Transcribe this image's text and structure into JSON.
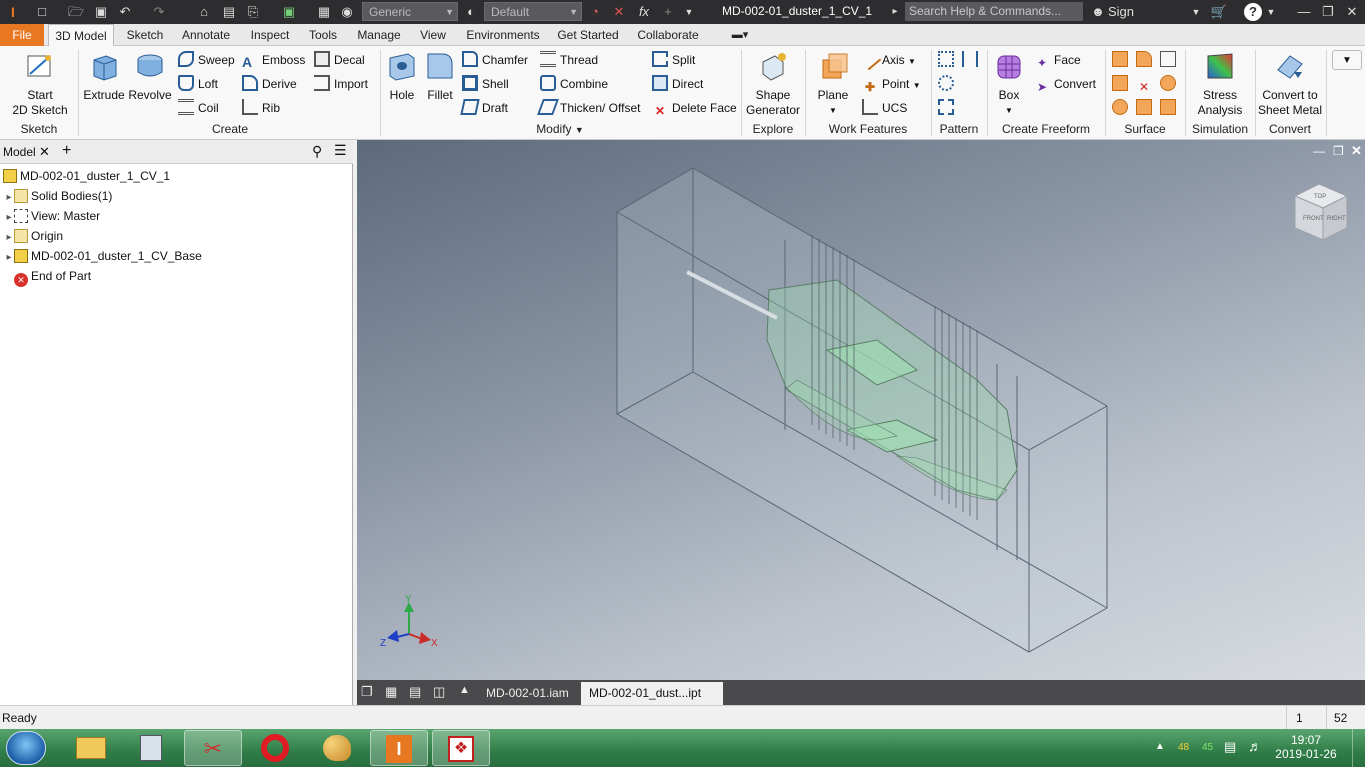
{
  "titlebar": {
    "material": "Generic",
    "appearance": "Default",
    "document_title": "MD-002-01_duster_1_CV_1",
    "search_placeholder": "Search Help & Commands...",
    "sign_in": "Sign In",
    "fx": "fx"
  },
  "tabs": [
    "File",
    "3D Model",
    "Sketch",
    "Annotate",
    "Inspect",
    "Tools",
    "Manage",
    "View",
    "Environments",
    "Get Started",
    "Collaborate"
  ],
  "ribbon": {
    "sketch": {
      "start_line1": "Start",
      "start_line2": "2D Sketch",
      "title": "Sketch"
    },
    "create": {
      "extrude": "Extrude",
      "revolve": "Revolve",
      "sweep": "Sweep",
      "loft": "Loft",
      "coil": "Coil",
      "emboss": "Emboss",
      "derive": "Derive",
      "rib": "Rib",
      "decal": "Decal",
      "import": "Import",
      "title": "Create"
    },
    "modify": {
      "hole": "Hole",
      "fillet": "Fillet",
      "chamfer": "Chamfer",
      "shell": "Shell",
      "draft": "Draft",
      "thread": "Thread",
      "combine": "Combine",
      "thicken": "Thicken/ Offset",
      "split": "Split",
      "direct": "Direct",
      "delete_face": "Delete Face",
      "title": "Modify"
    },
    "explore": {
      "line1": "Shape",
      "line2": "Generator",
      "title": "Explore"
    },
    "work": {
      "plane": "Plane",
      "axis": "Axis",
      "point": "Point",
      "ucs": "UCS",
      "title": "Work Features"
    },
    "pattern": {
      "title": "Pattern"
    },
    "freeform": {
      "box": "Box",
      "face": "Face",
      "convert": "Convert",
      "title": "Create Freeform"
    },
    "surface": {
      "title": "Surface"
    },
    "simulation": {
      "line1": "Stress",
      "line2": "Analysis",
      "title": "Simulation"
    },
    "convert": {
      "line1": "Convert to",
      "line2": "Sheet Metal",
      "title": "Convert"
    }
  },
  "browser": {
    "tab": "Model",
    "items": [
      {
        "label": "MD-002-01_duster_1_CV_1",
        "indent": 0
      },
      {
        "label": "Solid Bodies(1)",
        "indent": 1
      },
      {
        "label": "View: Master",
        "indent": 1
      },
      {
        "label": "Origin",
        "indent": 1
      },
      {
        "label": "MD-002-01_duster_1_CV_Base",
        "indent": 1
      },
      {
        "label": "End of Part",
        "indent": 1
      }
    ]
  },
  "viewcube": {
    "front": "FRONT",
    "right": "RIGHT",
    "top": "TOP"
  },
  "triad": {
    "x": "X",
    "y": "Y",
    "z": "Z"
  },
  "document_tabs": [
    "MD-002-01.iam",
    "MD-002-01_dust...ipt"
  ],
  "status": {
    "text": "Ready",
    "count1": "1",
    "count2": "52"
  },
  "taskbar": {
    "time": "19:07",
    "date": "2019-01-26",
    "tray1": "48",
    "tray2": "45"
  },
  "colors": {
    "file_tab": "#e87722",
    "titlebar": "#2d2d30",
    "taskbar": "#3b8f55",
    "model_edges": "#5a6574",
    "model_highlight": "#9fe0b0"
  }
}
